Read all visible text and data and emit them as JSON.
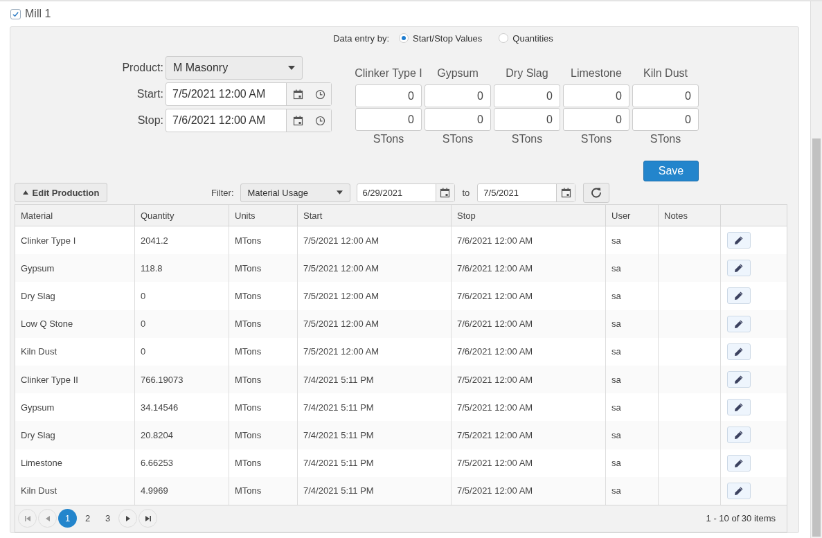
{
  "section": {
    "title": "Mill 1",
    "checked": true
  },
  "entry_mode": {
    "label": "Data entry by:",
    "options": [
      {
        "label": "Start/Stop Values",
        "selected": true
      },
      {
        "label": "Quantities",
        "selected": false
      }
    ]
  },
  "form": {
    "product_label": "Product:",
    "product": "M Masonry",
    "start_label": "Start:",
    "start": "7/5/2021 12:00 AM",
    "stop_label": "Stop:",
    "stop": "7/6/2021 12:00 AM"
  },
  "materials": [
    {
      "name": "Clinker Type I",
      "start_value": "0",
      "stop_value": "0",
      "unit": "STons"
    },
    {
      "name": "Gypsum",
      "start_value": "0",
      "stop_value": "0",
      "unit": "STons"
    },
    {
      "name": "Dry Slag",
      "start_value": "0",
      "stop_value": "0",
      "unit": "STons"
    },
    {
      "name": "Limestone",
      "start_value": "0",
      "stop_value": "0",
      "unit": "STons"
    },
    {
      "name": "Kiln Dust",
      "start_value": "0",
      "stop_value": "0",
      "unit": "STons"
    }
  ],
  "save_button": "Save",
  "toolbar": {
    "edit_button": "Edit Production",
    "expanded": true,
    "filter_label": "Filter:",
    "filter": "Material Usage",
    "from": "6/29/2021",
    "to_label": "to",
    "to": "7/5/2021"
  },
  "table": {
    "columns": [
      "Material",
      "Quantity",
      "Units",
      "Start",
      "Stop",
      "User",
      "Notes"
    ],
    "rows": [
      [
        "Clinker Type I",
        "2041.2",
        "MTons",
        "7/5/2021 12:00 AM",
        "7/6/2021 12:00 AM",
        "sa",
        ""
      ],
      [
        "Gypsum",
        "118.8",
        "MTons",
        "7/5/2021 12:00 AM",
        "7/6/2021 12:00 AM",
        "sa",
        ""
      ],
      [
        "Dry Slag",
        "0",
        "MTons",
        "7/5/2021 12:00 AM",
        "7/6/2021 12:00 AM",
        "sa",
        ""
      ],
      [
        "Low Q Stone",
        "0",
        "MTons",
        "7/5/2021 12:00 AM",
        "7/6/2021 12:00 AM",
        "sa",
        ""
      ],
      [
        "Kiln Dust",
        "0",
        "MTons",
        "7/5/2021 12:00 AM",
        "7/6/2021 12:00 AM",
        "sa",
        ""
      ],
      [
        "Clinker Type II",
        "766.19073",
        "MTons",
        "7/4/2021 5:11 PM",
        "7/5/2021 12:00 AM",
        "sa",
        ""
      ],
      [
        "Gypsum",
        "34.14546",
        "MTons",
        "7/4/2021 5:11 PM",
        "7/5/2021 12:00 AM",
        "sa",
        ""
      ],
      [
        "Dry Slag",
        "20.8204",
        "MTons",
        "7/4/2021 5:11 PM",
        "7/5/2021 12:00 AM",
        "sa",
        ""
      ],
      [
        "Limestone",
        "6.66253",
        "MTons",
        "7/4/2021 5:11 PM",
        "7/5/2021 12:00 AM",
        "sa",
        ""
      ],
      [
        "Kiln Dust",
        "4.9969",
        "MTons",
        "7/4/2021 5:11 PM",
        "7/5/2021 12:00 AM",
        "sa",
        ""
      ]
    ]
  },
  "pager": {
    "pages": [
      {
        "label": "1",
        "selected": true
      },
      {
        "label": "2",
        "selected": false
      },
      {
        "label": "3",
        "selected": false
      }
    ],
    "info": "1 - 10 of 30 items"
  }
}
